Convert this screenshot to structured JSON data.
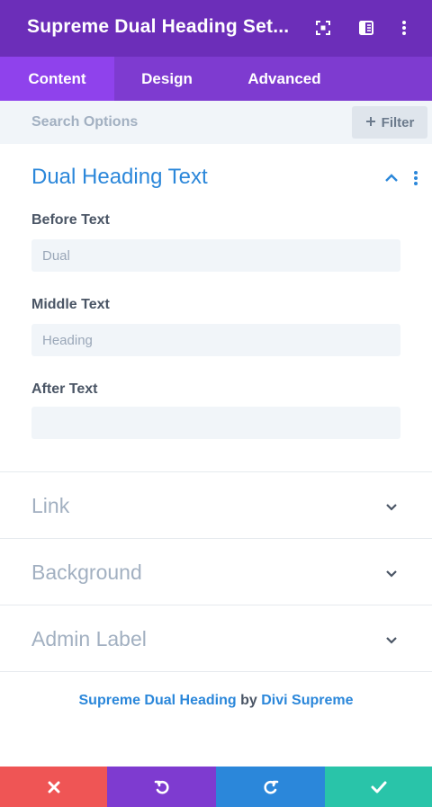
{
  "header": {
    "title": "Supreme Dual Heading Set...",
    "icons": [
      "expand-icon",
      "sidebar-icon",
      "more-vertical-icon"
    ]
  },
  "tabs": [
    {
      "label": "Content",
      "active": true
    },
    {
      "label": "Design",
      "active": false
    },
    {
      "label": "Advanced",
      "active": false
    }
  ],
  "search": {
    "placeholder": "Search Options",
    "filter_label": "Filter"
  },
  "groups": {
    "dual_heading_text": {
      "title": "Dual Heading Text",
      "fields": [
        {
          "label": "Before Text",
          "value": "Dual"
        },
        {
          "label": "Middle Text",
          "value": "Heading"
        },
        {
          "label": "After Text",
          "value": ""
        }
      ]
    },
    "collapsed": [
      {
        "title": "Link"
      },
      {
        "title": "Background"
      },
      {
        "title": "Admin Label"
      }
    ]
  },
  "footer": {
    "module_link": "Supreme Dual Heading",
    "by": "by",
    "author_link": "Divi Supreme"
  },
  "actions": {
    "colors": {
      "discard": "#ef5555",
      "undo": "#7e3bd0",
      "redo": "#2b87da",
      "save": "#29c4a9"
    }
  },
  "colors": {
    "header": "#6c2eb9",
    "tabs": "#7e3bd0",
    "tab_active": "#8f42ec",
    "accent": "#2b87da"
  }
}
